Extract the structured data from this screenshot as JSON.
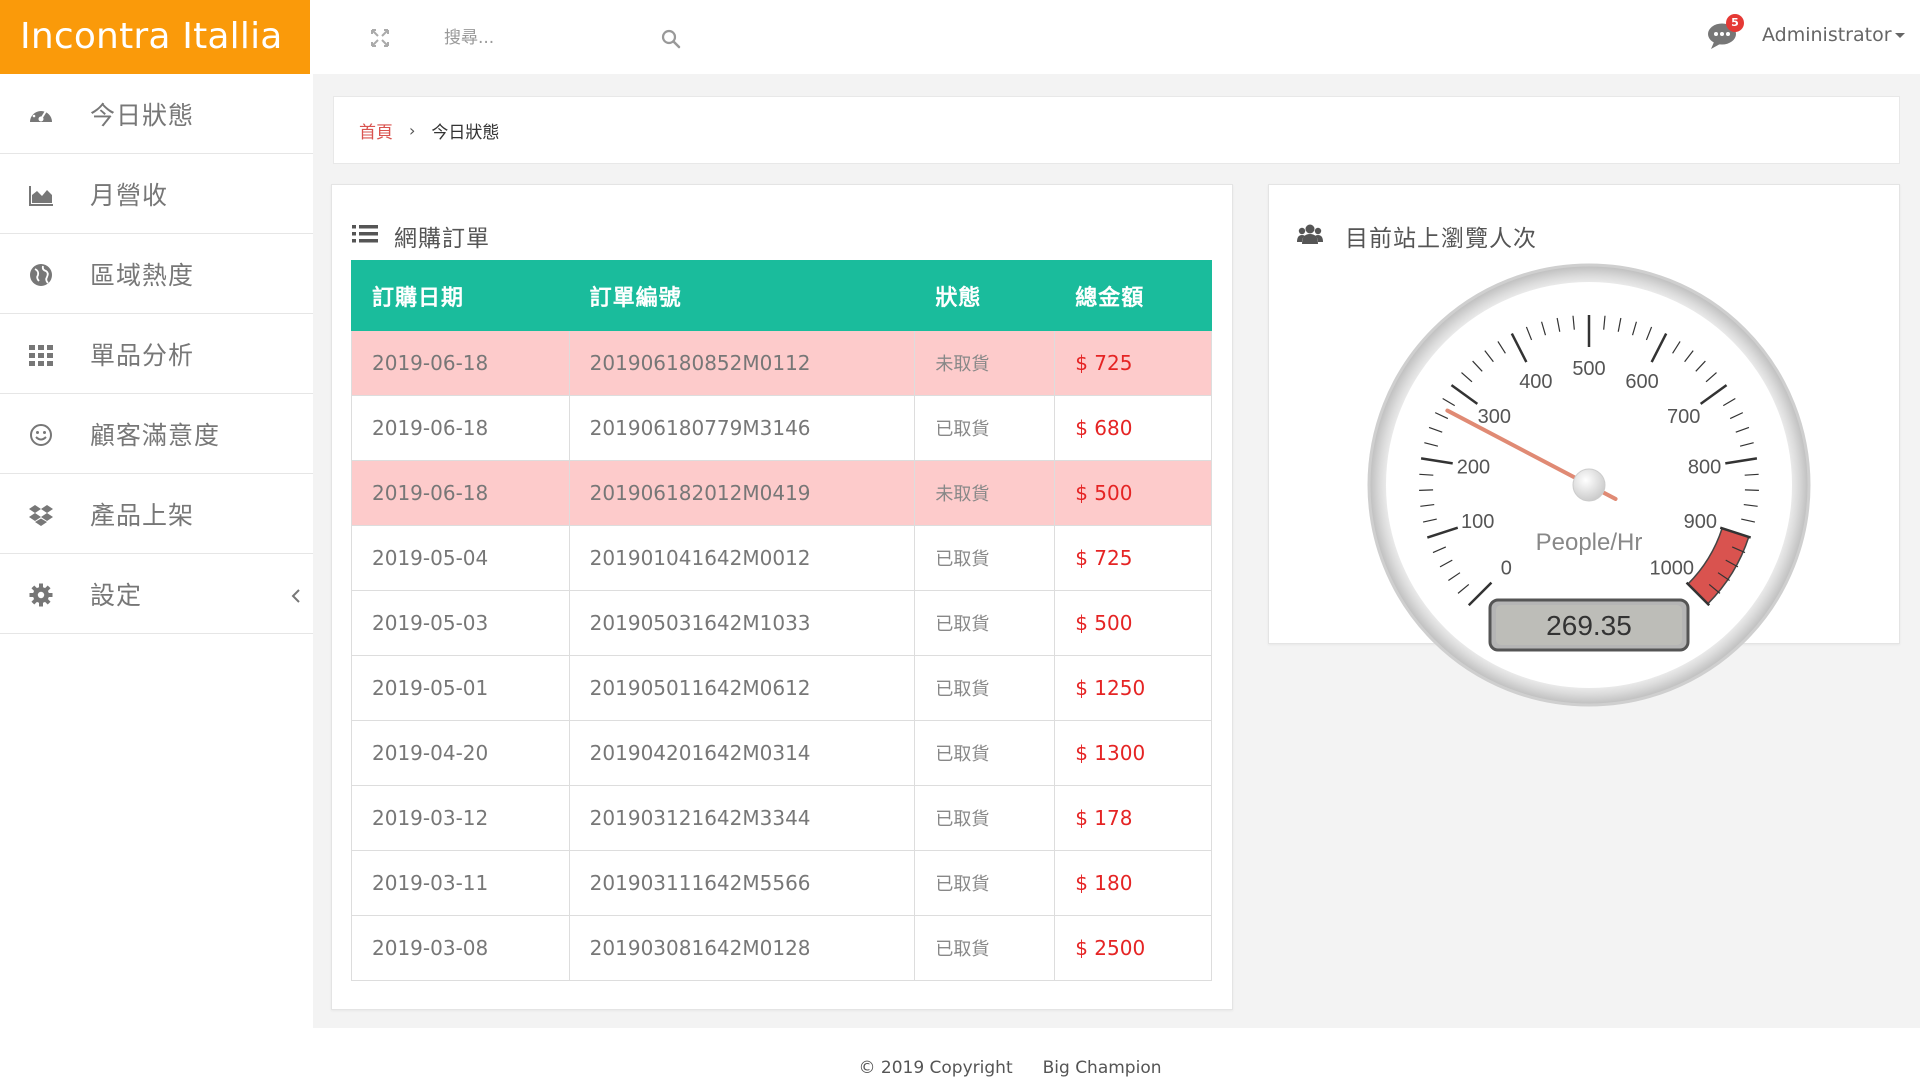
{
  "brand": {
    "name": "Incontra Itallia",
    "color": "#fa9a0a"
  },
  "header": {
    "search_placeholder": "搜尋...",
    "message_count": "5",
    "user_name": "Administrator"
  },
  "sidebar": {
    "items": [
      {
        "label": "今日狀態",
        "icon": "dashboard-icon"
      },
      {
        "label": "月營收",
        "icon": "area-chart-icon"
      },
      {
        "label": "區域熱度",
        "icon": "globe-icon"
      },
      {
        "label": "單品分析",
        "icon": "grid-icon"
      },
      {
        "label": "顧客滿意度",
        "icon": "smile-icon"
      },
      {
        "label": "產品上架",
        "icon": "dropbox-icon"
      },
      {
        "label": "設定",
        "icon": "gear-icon"
      }
    ]
  },
  "breadcrumb": {
    "home": "首頁",
    "separator": "›",
    "current": "今日狀態"
  },
  "orders": {
    "title": "網購訂單",
    "header_color": "#1abc9c",
    "pending_color": "#fdcbcb",
    "columns": [
      "訂購日期",
      "訂單編號",
      "狀態",
      "總金額"
    ],
    "rows": [
      {
        "date": "2019-06-18",
        "order_no": "201906180852M0112",
        "status": "未取貨",
        "amount": "$ 725",
        "pending": true
      },
      {
        "date": "2019-06-18",
        "order_no": "201906180779M3146",
        "status": "已取貨",
        "amount": "$ 680",
        "pending": false
      },
      {
        "date": "2019-06-18",
        "order_no": "201906182012M0419",
        "status": "未取貨",
        "amount": "$ 500",
        "pending": true
      },
      {
        "date": "2019-05-04",
        "order_no": "201901041642M0012",
        "status": "已取貨",
        "amount": "$ 725",
        "pending": false
      },
      {
        "date": "2019-05-03",
        "order_no": "201905031642M1033",
        "status": "已取貨",
        "amount": "$ 500",
        "pending": false
      },
      {
        "date": "2019-05-01",
        "order_no": "201905011642M0612",
        "status": "已取貨",
        "amount": "$ 1250",
        "pending": false
      },
      {
        "date": "2019-04-20",
        "order_no": "201904201642M0314",
        "status": "已取貨",
        "amount": "$ 1300",
        "pending": false
      },
      {
        "date": "2019-03-12",
        "order_no": "201903121642M3344",
        "status": "已取貨",
        "amount": "$ 178",
        "pending": false
      },
      {
        "date": "2019-03-11",
        "order_no": "201903111642M5566",
        "status": "已取貨",
        "amount": "$ 180",
        "pending": false
      },
      {
        "date": "2019-03-08",
        "order_no": "201903081642M0128",
        "status": "已取貨",
        "amount": "$ 2500",
        "pending": false
      }
    ]
  },
  "visitors": {
    "title": "目前站上瀏覽人次",
    "gauge": {
      "min": 0,
      "max": 1000,
      "value": 269.35,
      "value_text": "269.35",
      "unit": "People/Hr",
      "major_labels": [
        "0",
        "100",
        "200",
        "300",
        "400",
        "500",
        "600",
        "700",
        "800",
        "900",
        "1000"
      ],
      "red_band_from": 900,
      "red_band_to": 1000,
      "red_band_color": "#d9534f"
    }
  },
  "footer": {
    "copyright": "© 2019 Copyright",
    "company": "Big Champion"
  }
}
